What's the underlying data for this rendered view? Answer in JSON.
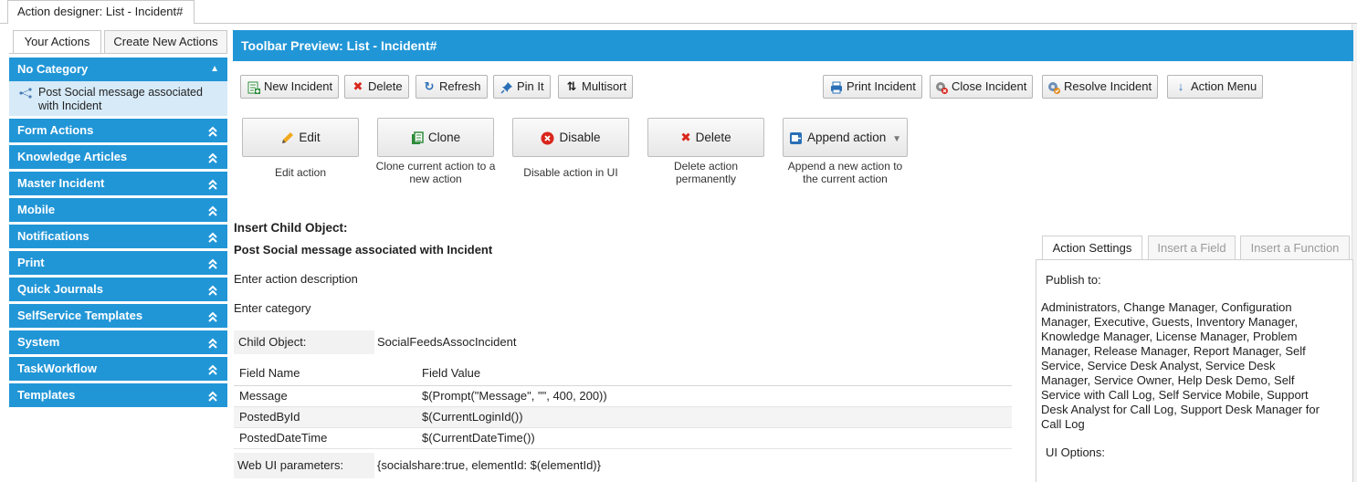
{
  "window": {
    "tab_title": "Action designer: List - Incident#"
  },
  "left_tabs": [
    "Your Actions",
    "Create New Actions"
  ],
  "sidebar": {
    "open_category": "No Category",
    "open_items": [
      "Post Social message associated with Incident"
    ],
    "categories": [
      "Form Actions",
      "Knowledge Articles",
      "Master Incident",
      "Mobile",
      "Notifications",
      "Print",
      "Quick Journals",
      "SelfService Templates",
      "System",
      "TaskWorkflow",
      "Templates"
    ]
  },
  "main": {
    "title": "Toolbar Preview: List - Incident#",
    "toolbar": {
      "new_incident": "New Incident",
      "delete": "Delete",
      "refresh": "Refresh",
      "pin_it": "Pin It",
      "multisort": "Multisort",
      "print_incident": "Print Incident",
      "close_incident": "Close Incident",
      "resolve_incident": "Resolve Incident",
      "action_menu": "Action Menu"
    },
    "actions": {
      "edit": {
        "label": "Edit",
        "caption": "Edit action"
      },
      "clone": {
        "label": "Clone",
        "caption": "Clone current action to a new action"
      },
      "disable": {
        "label": "Disable",
        "caption": "Disable action in UI"
      },
      "delete": {
        "label": "Delete",
        "caption": "Delete action permanently"
      },
      "append": {
        "label": "Append action",
        "caption": "Append a new action to the current action"
      }
    },
    "insert_title": "Insert Child Object:",
    "action_name": "Post Social message associated with Incident",
    "description_placeholder": "Enter action description",
    "category_placeholder": "Enter category",
    "child_object_label": "Child Object:",
    "child_object_value": "SocialFeedsAssocIncident",
    "field_table": {
      "headers": [
        "Field Name",
        "Field Value"
      ],
      "rows": [
        [
          "Message",
          "$(Prompt(\"Message\", \"\", 400, 200))"
        ],
        [
          "PostedById",
          "$(CurrentLoginId())"
        ],
        [
          "PostedDateTime",
          "$(CurrentDateTime())"
        ]
      ]
    },
    "webui_label": "Web UI parameters:",
    "webui_value": "{socialshare:true, elementId: $(elementId)}"
  },
  "settings": {
    "tabs": [
      "Action Settings",
      "Insert a Field",
      "Insert a Function"
    ],
    "publish_label": "Publish to:",
    "publish_lines": [
      "Administrators, Change Manager, Configuration",
      "Manager, Executive, Guests, Inventory Manager,",
      "Knowledge Manager, License Manager, Problem",
      "Manager, Release Manager, Report Manager, Self",
      "Service, Service Desk Analyst, Service Desk",
      "Manager, Service Owner, Help Desk Demo, Self",
      "Service with Call Log, Self Service Mobile, Support",
      "Desk Analyst for Call Log, Support Desk Manager for",
      "Call Log"
    ],
    "ui_options_label": "UI Options:"
  },
  "colors": {
    "accent": "#2196d7",
    "item_bg": "#d6eaf8"
  }
}
